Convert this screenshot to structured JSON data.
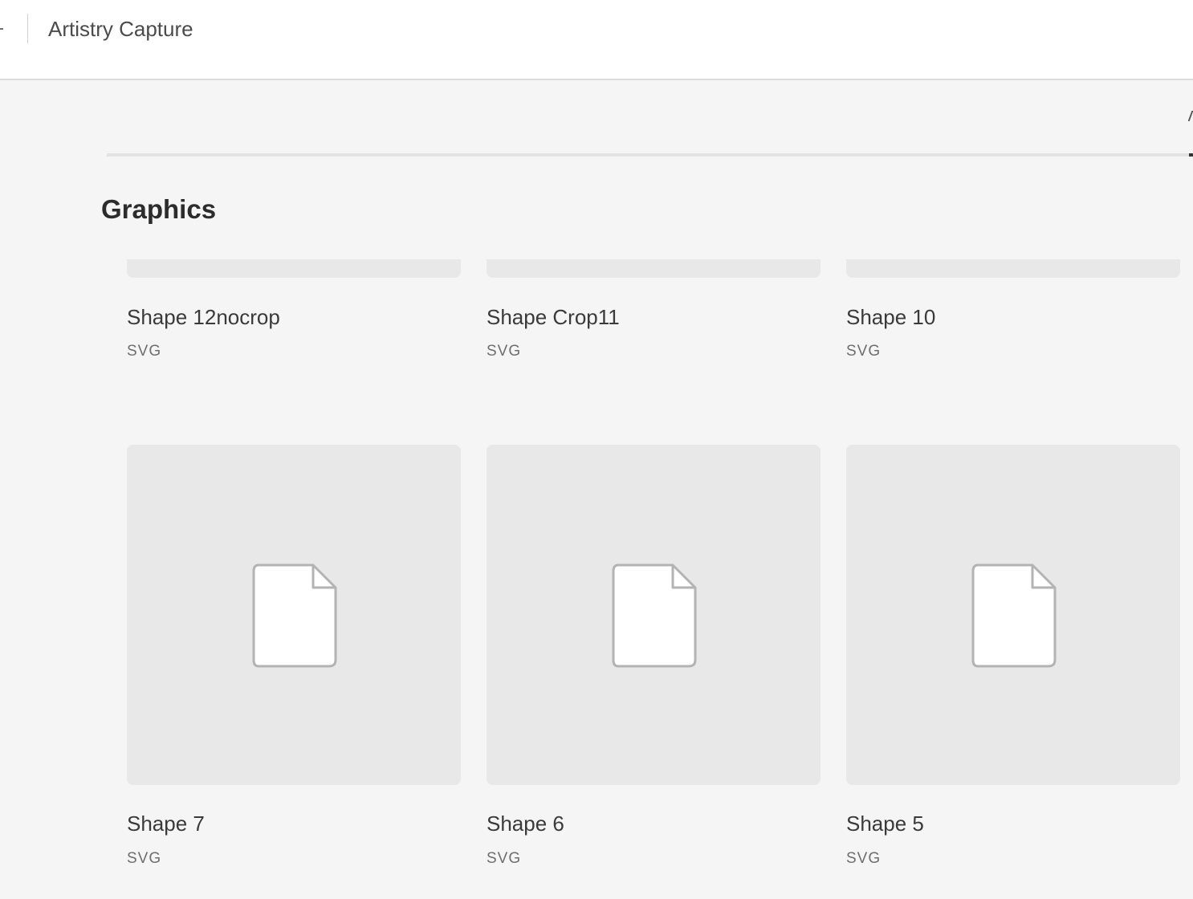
{
  "header": {
    "app_title": "Artistry Capture"
  },
  "section": {
    "title": "Graphics"
  },
  "cards": [
    {
      "name": "Shape 12nocrop",
      "type": "SVG"
    },
    {
      "name": "Shape Crop11",
      "type": "SVG"
    },
    {
      "name": "Shape 10",
      "type": "SVG"
    },
    {
      "name": "Shape 7",
      "type": "SVG"
    },
    {
      "name": "Shape 6",
      "type": "SVG"
    },
    {
      "name": "Shape 5",
      "type": "SVG"
    }
  ],
  "icons": {
    "thumbnail_placeholder": "file-icon"
  },
  "colors": {
    "page_background": "#f5f5f5",
    "header_background": "#ffffff",
    "thumbnail_background": "#e8e8e8",
    "file_icon_fill": "#ffffff",
    "file_icon_stroke": "#b3b3b3"
  }
}
